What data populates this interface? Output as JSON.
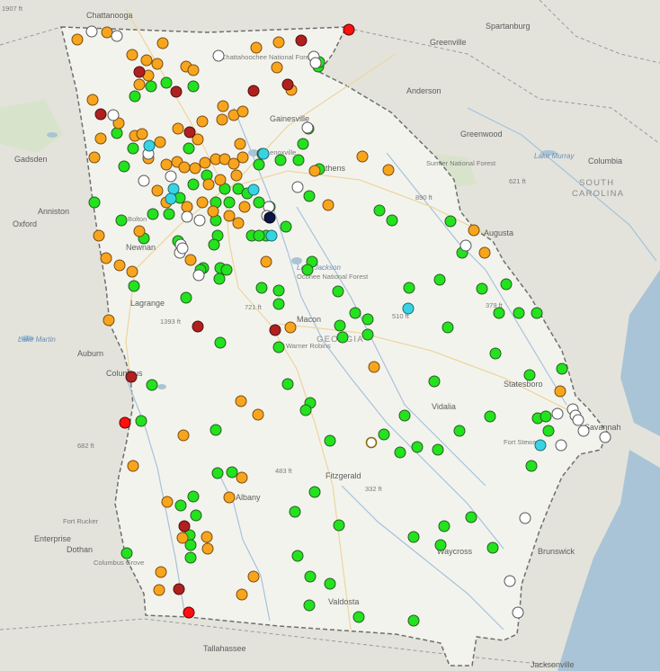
{
  "colors": {
    "water": "#a9c4d6",
    "land_outside": "#e3e3dc",
    "georgia": "#f3f3ee",
    "border": "#777777",
    "forest": "#d8e3cc",
    "river": "#a6c2db",
    "road": "#f0d9a2",
    "stations": {
      "green": "#22e31d",
      "orange": "#f7a51d",
      "darkred": "#b0201f",
      "red": "#ff1010",
      "white": "#ffffff",
      "cyan": "#38d3e3",
      "navy": "#0d1547",
      "hollow": "#ffffff"
    }
  },
  "labels": {
    "cities": [
      {
        "name": "Chattanooga"
      },
      {
        "name": "Greenville"
      },
      {
        "name": "Spartanburg"
      },
      {
        "name": "Anderson"
      },
      {
        "name": "Gainesville"
      },
      {
        "name": "Gadsden"
      },
      {
        "name": "Athens"
      },
      {
        "name": "Greenwood"
      },
      {
        "name": "Anniston"
      },
      {
        "name": "Oxford"
      },
      {
        "name": "Columbia"
      },
      {
        "name": "Newnan"
      },
      {
        "name": "Augusta"
      },
      {
        "name": "Lagrange"
      },
      {
        "name": "Macon"
      },
      {
        "name": "Auburn"
      },
      {
        "name": "Columbus"
      },
      {
        "name": "Statesboro"
      },
      {
        "name": "Vidalia"
      },
      {
        "name": "Savannah"
      },
      {
        "name": "Fitzgerald"
      },
      {
        "name": "Albany"
      },
      {
        "name": "Enterprise"
      },
      {
        "name": "Dothan"
      },
      {
        "name": "Waycross"
      },
      {
        "name": "Brunswick"
      },
      {
        "name": "Valdosta"
      },
      {
        "name": "Tallahassee"
      },
      {
        "name": "Jacksonville"
      },
      {
        "name": "Lenoxville"
      },
      {
        "name": "Warner Robins"
      },
      {
        "name": "Bolton"
      },
      {
        "name": "Fort Stewart"
      },
      {
        "name": "Fort Rucker"
      },
      {
        "name": "Columbus Grove"
      }
    ],
    "states": [
      {
        "name": "SOUTH"
      },
      {
        "name": "CAROLINA"
      },
      {
        "name": "GEORGIA"
      }
    ],
    "features": [
      {
        "name": "Chattahoochee National Forest"
      },
      {
        "name": "Sumter National Forest"
      },
      {
        "name": "Oconee National Forest"
      },
      {
        "name": "Lake Martin"
      },
      {
        "name": "Lake Murray"
      },
      {
        "name": "Lake Jackson"
      }
    ],
    "elevations": [
      {
        "text": "890 ft"
      },
      {
        "text": "621 ft"
      },
      {
        "text": "510 ft"
      },
      {
        "text": "379 ft"
      },
      {
        "text": "721 ft"
      },
      {
        "text": "1393 ft"
      },
      {
        "text": "483 ft"
      },
      {
        "text": "332 ft"
      },
      {
        "text": "682 ft"
      },
      {
        "text": "1907 ft"
      }
    ]
  },
  "station_counts": {
    "green": 120,
    "orange": 75,
    "darkred": 11,
    "red": 3,
    "white": 30,
    "cyan": 8,
    "navy": 1,
    "hollow": 1
  }
}
